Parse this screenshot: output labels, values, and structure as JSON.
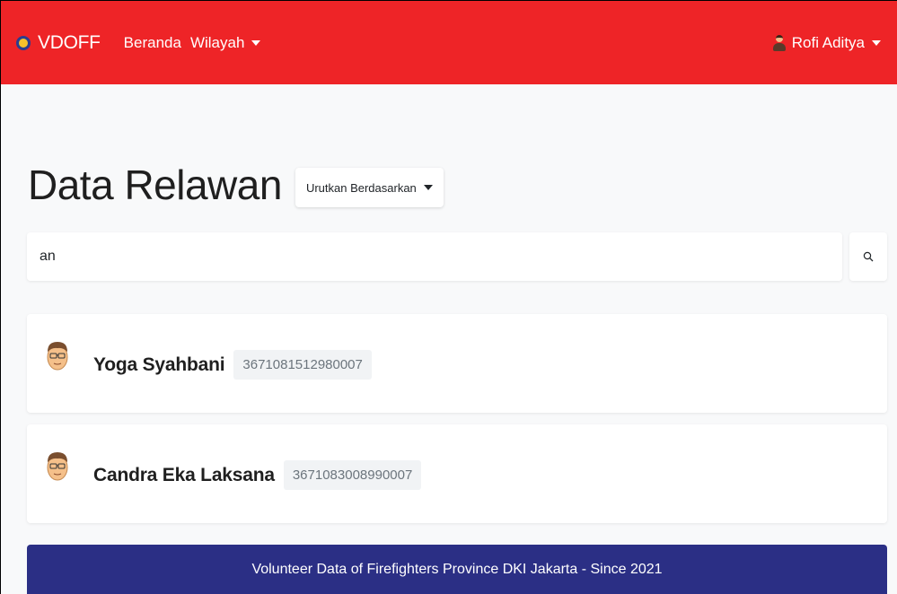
{
  "navbar": {
    "brand": "VDOFF",
    "links": [
      "Beranda",
      "Wilayah"
    ],
    "user_name": "Rofi Aditya",
    "background_color": "#ee2427"
  },
  "page": {
    "title": "Data Relawan",
    "sort_label": "Urutkan Berdasarkan"
  },
  "search": {
    "value": "an",
    "icon": "search-icon"
  },
  "volunteers": [
    {
      "name": "Yoga Syahbani",
      "nik": "3671081512980007",
      "avatar": "avatar-icon"
    },
    {
      "name": "Candra Eka Laksana",
      "nik": "3671083008990007",
      "avatar": "avatar-icon"
    }
  ],
  "footer": {
    "text": "Volunteer Data of Firefighters Province DKI Jakarta - Since 2021",
    "background_color": "#2b2f85"
  }
}
